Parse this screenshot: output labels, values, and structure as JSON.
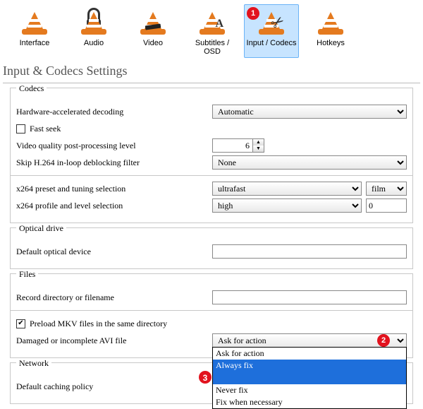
{
  "toolbar": {
    "items": [
      {
        "label": "Interface"
      },
      {
        "label": "Audio"
      },
      {
        "label": "Video"
      },
      {
        "label": "Subtitles / OSD"
      },
      {
        "label": "Input / Codecs"
      },
      {
        "label": "Hotkeys"
      }
    ]
  },
  "page_title": "Input & Codecs Settings",
  "codecs": {
    "legend": "Codecs",
    "hw_decoding_label": "Hardware-accelerated decoding",
    "hw_decoding_value": "Automatic",
    "fast_seek_label": "Fast seek",
    "vq_pp_label": "Video quality post-processing level",
    "vq_pp_value": "6",
    "skip_h264_label": "Skip H.264 in-loop deblocking filter",
    "skip_h264_value": "None",
    "x264_preset_label": "x264 preset and tuning selection",
    "x264_preset_value": "ultrafast",
    "x264_tuning_value": "film",
    "x264_profile_label": "x264 profile and level selection",
    "x264_profile_value": "high",
    "x264_level_value": "0"
  },
  "optical": {
    "legend": "Optical drive",
    "default_device_label": "Default optical device",
    "default_device_value": ""
  },
  "files": {
    "legend": "Files",
    "record_dir_label": "Record directory or filename",
    "record_dir_value": "",
    "preload_mkv_label": "Preload MKV files in the same directory",
    "avi_label": "Damaged or incomplete AVI file",
    "avi_value": "Ask for action",
    "avi_options": [
      "Ask for action",
      "Always fix",
      "Never fix",
      "Fix when necessary"
    ]
  },
  "network": {
    "legend": "Network",
    "caching_label": "Default caching policy"
  },
  "badges": {
    "b1": "1",
    "b2": "2",
    "b3": "3"
  }
}
